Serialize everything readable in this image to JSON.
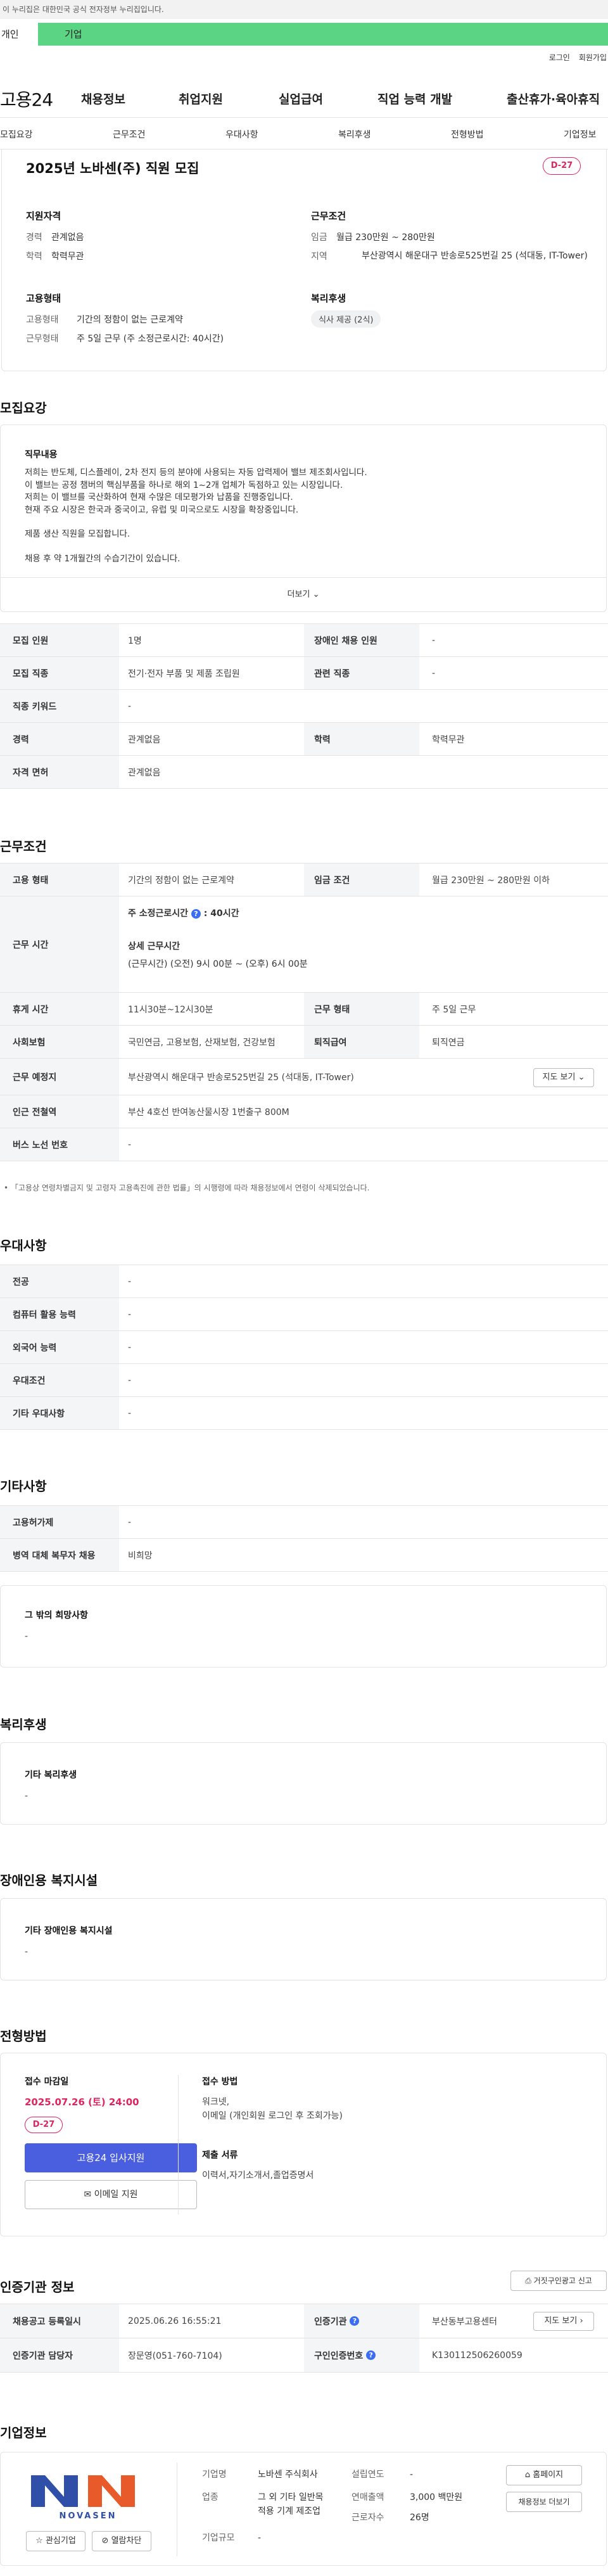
{
  "gov_banner": "이 누리집은 대한민국 공식 전자정부 누리집입니다.",
  "tabs": {
    "personal": "개인",
    "company": "기업"
  },
  "util": {
    "login": "로그인",
    "join": "회원가입"
  },
  "logo": "고용24",
  "gnb": [
    "채용정보",
    "취업지원",
    "실업급여",
    "직업 능력 개발",
    "출산휴가·육아휴직"
  ],
  "snb": [
    "모집요강",
    "근무조건",
    "우대사항",
    "복리후생",
    "전형방법",
    "기업정보"
  ],
  "summary": {
    "title": "2025년 노바센(주) 직원 모집",
    "dday": "D-27",
    "qual_title": "지원자격",
    "work_title": "근무조건",
    "career_k": "경력",
    "career_v": "관계없음",
    "edu_k": "학력",
    "edu_v": "학력무관",
    "wage_k": "임금",
    "wage_v": "월급 230만원 ~ 280만원",
    "area_k": "지역",
    "area_v": "부산광역시 해운대구 반송로525번길 25 (석대동, IT-Tower)",
    "emp_title": "고용형태",
    "benefit_title": "복리후생",
    "emptype_k": "고용형태",
    "emptype_v": "기간의 정함이 없는 근로계약",
    "worktype_k": "근무형태",
    "worktype_v": "주 5일 근무 (주 소정근로시간: 40시간)",
    "benefit_tag": "식사 제공 (2식)"
  },
  "recruit": {
    "section": "모집요강",
    "duty_title": "직무내용",
    "duty_lines": [
      "저희는 반도체, 디스플레이, 2차 전지 등의 분야에 사용되는 자동 압력제어 밸브 제조회사입니다.",
      "이 밸브는 공정 챔버의 핵심부품을 하나로 해외 1~2개 업체가 독점하고 있는 시장입니다.",
      "저희는 이 밸브를 국산화하여 현재 수많은 데모평가와 납품을 진행중입니다.",
      "현재 주요 시장은 한국과 중국이고, 유럽 및 미국으로도 시장을 확장중입니다.",
      "",
      "제품 생산 직원을 모집합니다.",
      "",
      "채용 후 약 1개월간의 수습기간이 있습니다."
    ],
    "more": "더보기",
    "rows": [
      {
        "k": "모집 인원",
        "v": "1명",
        "k2": "장애인 채용 인원",
        "v2": "-"
      },
      {
        "k": "모집 직종",
        "v": "전기·전자 부품 및 제품 조립원",
        "k2": "관련 직종",
        "v2": "-"
      },
      {
        "k": "직종 키워드",
        "v": "-"
      },
      {
        "k": "경력",
        "v": "관계없음",
        "k2": "학력",
        "v2": "학력무관"
      },
      {
        "k": "자격 면허",
        "v": "관계없음"
      }
    ]
  },
  "work": {
    "section": "근무조건",
    "emp_k": "고용 형태",
    "emp_v": "기간의 정함이 없는 근로계약",
    "wage_k": "임금 조건",
    "wage_v": "월급 230만원 ~ 280만원 이하",
    "hours_k": "근무 시간",
    "hours_main": "주 소정근로시간",
    "hours_val": ": 40시간",
    "hours_detail_title": "상세 근무시간",
    "hours_detail": "(근무시간) (오전) 9시 00분 ~ (오후) 6시 00분",
    "break_k": "휴게 시간",
    "break_v": "11시30분~12시30분",
    "form_k": "근무 형태",
    "form_v": "주 5일 근무",
    "ins_k": "사회보험",
    "ins_v": "국민연금, 고용보험, 산재보험, 건강보험",
    "ret_k": "퇴직급여",
    "ret_v": "퇴직연금",
    "place_k": "근무 예정지",
    "place_v": "부산광역시 해운대구 반송로525번길 25 (석대동, IT-Tower)",
    "map_btn": "지도 보기",
    "subway_k": "인근 전철역",
    "subway_v": "부산 4호선 반여농산물시장 1번출구 800M",
    "bus_k": "버스 노선 번호",
    "bus_v": "-",
    "note": "「고용상 연령차별금지 및 고령자 고용촉진에 관한 법률」의 시행령에 따라 채용정보에서 연령이 삭제되었습니다."
  },
  "pref": {
    "section": "우대사항",
    "rows": [
      {
        "k": "전공",
        "v": "-"
      },
      {
        "k": "컴퓨터 활용 능력",
        "v": "-"
      },
      {
        "k": "외국어 능력",
        "v": "-"
      },
      {
        "k": "우대조건",
        "v": "-"
      },
      {
        "k": "기타 우대사항",
        "v": "-"
      }
    ]
  },
  "etc": {
    "section": "기타사항",
    "rows": [
      {
        "k": "고용허가제",
        "v": "-"
      },
      {
        "k": "병역 대체 복무자 채용",
        "v": "비희망"
      }
    ],
    "hope_title": "그 밖의 희망사항",
    "hope_v": "-"
  },
  "welfare": {
    "section": "복리후생",
    "title": "기타 복리후생",
    "v": "-"
  },
  "disabled": {
    "section": "장애인용 복지시설",
    "title": "기타 장애인용 복지시설",
    "v": "-"
  },
  "process": {
    "section": "전형방법",
    "deadline_title": "접수 마감일",
    "deadline": "2025.07.26 (토) 24:00",
    "dday": "D-27",
    "apply_btn": "고용24 입사지원",
    "email_btn": "이메일 지원",
    "method_title": "접수 방법",
    "method_v1": "워크넷,",
    "method_v2": "이메일 (개인회원 로그인 후 조회가능)",
    "docs_title": "제출 서류",
    "docs_v": "이력서,자기소개서,졸업증명서"
  },
  "cert": {
    "section": "인증기관 정보",
    "report_btn": "거짓구인광고 신고",
    "reg_k": "채용공고 등록일시",
    "reg_v": "2025.06.26 16:55:21",
    "agency_k": "인증기관",
    "agency_v": "부산동부고용센터",
    "map_btn": "지도 보기",
    "mgr_k": "인증기관 담당자",
    "mgr_v": "장문영(051-760-7104)",
    "no_k": "구인인증번호",
    "no_v": "K130112506260059"
  },
  "company": {
    "section": "기업정보",
    "logo_text": "NOVASEN",
    "name_k": "기업명",
    "name_v": "노바센 주식회사",
    "est_k": "설립연도",
    "est_v": "-",
    "ind_k": "업종",
    "ind_v1": "그 외 기타 일반목",
    "ind_v2": "적용 기계 제조업",
    "sales_k": "연매출액",
    "sales_v": "3,000 백만원",
    "emp_k": "근로자수",
    "emp_v": "26명",
    "size_k": "기업규모",
    "size_v": "-",
    "home_btn": "홈페이지",
    "list_btn": "채용정보 더보기",
    "fav_btn": "관심기업",
    "block_btn": "열람차단"
  }
}
